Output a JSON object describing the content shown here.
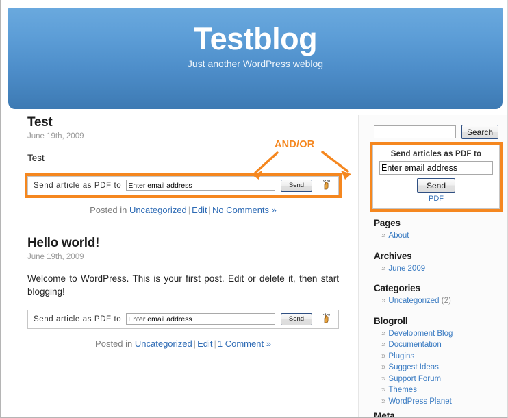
{
  "site": {
    "title": "Testblog",
    "tagline": "Just another WordPress weblog"
  },
  "annotation": {
    "and_or_label": "AND/OR",
    "accent_color": "#f5871f"
  },
  "posts": [
    {
      "title": "Test",
      "date": "June 19th, 2009",
      "body": "Test",
      "pdf_form": {
        "label": "Send article as PDF to",
        "email_value": "Enter email address",
        "send_label": "Send",
        "icon": "hand-pointer-icon",
        "highlighted": true
      },
      "meta": {
        "posted_in": "Posted in",
        "category": "Uncategorized",
        "edit": "Edit",
        "comments": "No Comments »"
      }
    },
    {
      "title": "Hello world!",
      "date": "June 19th, 2009",
      "body": "Welcome to WordPress. This is your first post. Edit or delete it, then start blogging!",
      "pdf_form": {
        "label": "Send article as PDF to",
        "email_value": "Enter email address",
        "send_label": "Send",
        "icon": "hand-pointer-icon",
        "highlighted": false
      },
      "meta": {
        "posted_in": "Posted in",
        "category": "Uncategorized",
        "edit": "Edit",
        "comments": "1 Comment »"
      }
    }
  ],
  "sidebar": {
    "search": {
      "value": "",
      "placeholder": "",
      "button_label": "Search"
    },
    "pdf_widget": {
      "title": "Send articles as PDF to",
      "email_value": "Enter email address",
      "send_label": "Send",
      "link_label": "PDF",
      "highlighted": true
    },
    "sections": [
      {
        "heading": "Pages",
        "items": [
          {
            "label": "About",
            "count": ""
          }
        ]
      },
      {
        "heading": "Archives",
        "items": [
          {
            "label": "June 2009",
            "count": ""
          }
        ]
      },
      {
        "heading": "Categories",
        "items": [
          {
            "label": "Uncategorized",
            "count": "(2)"
          }
        ]
      },
      {
        "heading": "Blogroll",
        "items": [
          {
            "label": "Development Blog",
            "count": ""
          },
          {
            "label": "Documentation",
            "count": ""
          },
          {
            "label": "Plugins",
            "count": ""
          },
          {
            "label": "Suggest Ideas",
            "count": ""
          },
          {
            "label": "Support Forum",
            "count": ""
          },
          {
            "label": "Themes",
            "count": ""
          },
          {
            "label": "WordPress Planet",
            "count": ""
          }
        ]
      }
    ],
    "meta_heading": "Meta",
    "bullet": "»"
  }
}
